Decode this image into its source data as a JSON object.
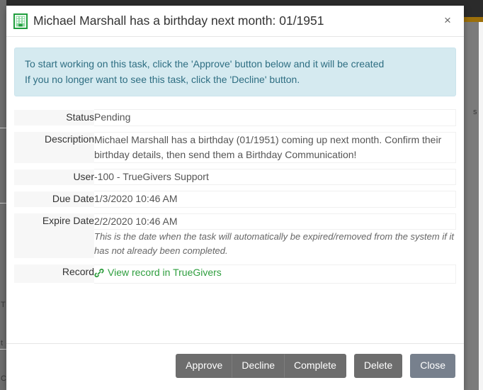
{
  "modal": {
    "title": "Michael Marshall has a birthday next month: 01/1951",
    "title_icon": "building-icon",
    "close_icon": "close-icon",
    "close_label": "×"
  },
  "alert": {
    "line1": "To start working on this task, click the 'Approve' button below and it will be created",
    "line2": "If you no longer want to see this task, click the 'Decline' button.",
    "bg_color": "#d5eaf0",
    "text_color": "#2e6e82"
  },
  "fields": [
    {
      "label": "Status",
      "value": "Pending"
    },
    {
      "label": "Description",
      "value": "Michael Marshall has a birthday (01/1951) coming up next month. Confirm their birthday details, then send them a Birthday Communication!"
    },
    {
      "label": "User",
      "value": "-100 - TrueGivers Support"
    },
    {
      "label": "Due Date",
      "value": "1/3/2020 10:46 AM"
    },
    {
      "label": "Expire Date",
      "value": "2/2/2020 10:46 AM",
      "help": "This is the date when the task will automatically be expired/removed from the system if it has not already been completed."
    },
    {
      "label": "Record",
      "link_text": "View record in TrueGivers",
      "link_icon": "chain-link-icon",
      "link_color": "#2e9e3e"
    }
  ],
  "footer": {
    "group_buttons": [
      {
        "label": "Approve"
      },
      {
        "label": "Decline"
      },
      {
        "label": "Complete"
      }
    ],
    "delete_label": "Delete",
    "close_label": "Close",
    "button_color": "#6d6d6d",
    "close_button_color": "#77808d"
  },
  "backdrop": {
    "ghost_left_1": "T",
    "ghost_left_2": "t",
    "ghost_left_3": "C",
    "ghost_left_4": "s"
  }
}
